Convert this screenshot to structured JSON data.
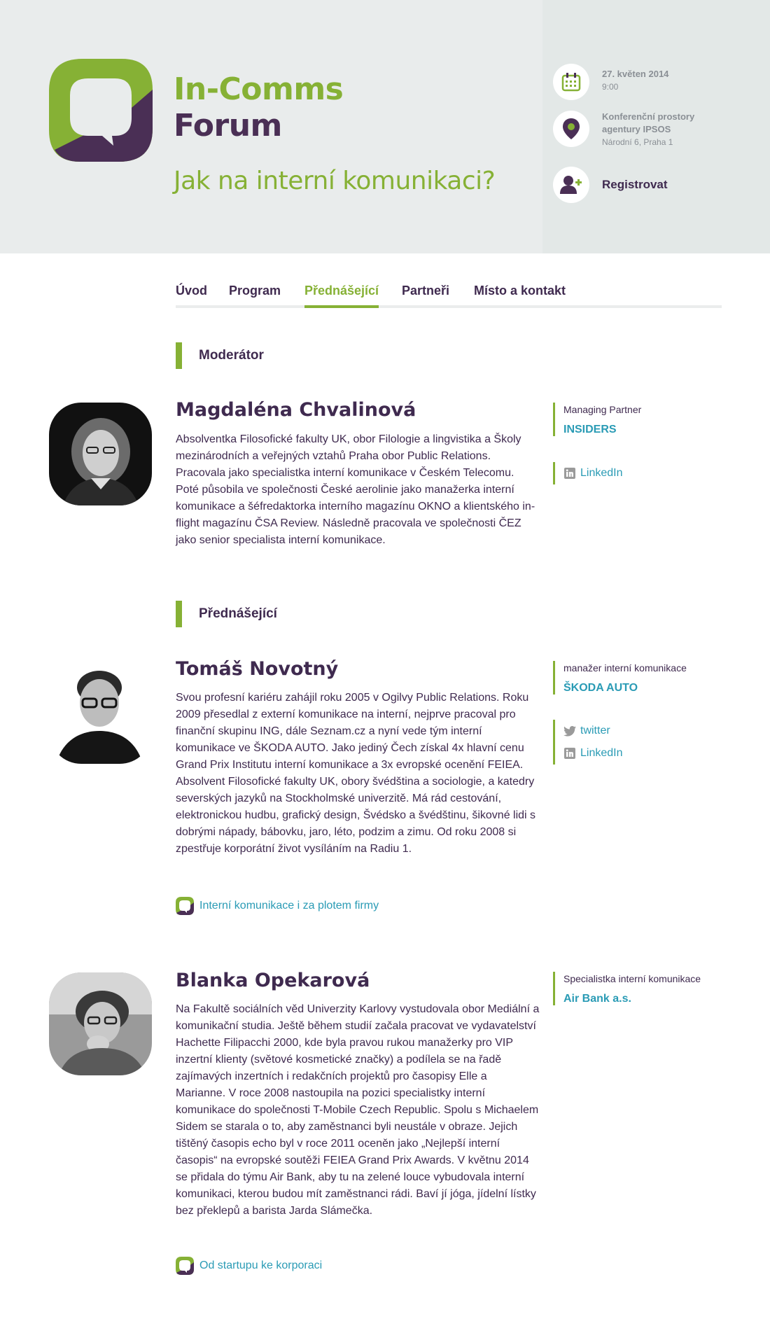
{
  "header": {
    "brand_line1": "In-Comms",
    "brand_line2": "Forum",
    "tagline": "Jak na interní komunikaci?",
    "date": "27. květen 2014",
    "time": "9:00",
    "venue_line1": "Konferenční prostory",
    "venue_line2": "agentury IPSOS",
    "venue_address": "Národní 6, Praha 1",
    "register_label": "Registrovat"
  },
  "nav": {
    "items": [
      "Úvod",
      "Program",
      "Přednášející",
      "Partneři",
      "Místo a kontakt"
    ],
    "active": "Přednášející"
  },
  "sections": {
    "moderator": "Moderátor",
    "speakers": "Přednášející"
  },
  "people": [
    {
      "name": "Magdaléna Chvalinová",
      "bio": "Absolventka Filosofické fakulty UK, obor Filologie a lingvistika a Školy mezinárodních a veřejných vztahů Praha obor Public Relations. Pracovala jako specialistka interní komunikace v Českém Telecomu. Poté působila ve společnosti České aerolinie jako manažerka interní komunikace a šéfredaktorka interního magazínu OKNO a klientského in-flight magazínu ČSA Review. Následně pracovala ve společnosti ČEZ jako senior specialista interní komunikace.",
      "role": "Managing Partner",
      "company": "INSIDERS",
      "links": [
        "LinkedIn"
      ]
    },
    {
      "name": "Tomáš Novotný",
      "bio": "Svou profesní kariéru zahájil roku 2005 v Ogilvy Public Relations. Roku 2009 přesedlal z externí komunikace na interní, nejprve pracoval pro finanční skupinu ING, dále Seznam.cz a nyní vede tým interní komunikace ve ŠKODA AUTO. Jako jediný Čech získal 4x hlavní cenu Grand Prix Institutu interní komunikace a 3x evropské ocenění FEIEA. Absolvent Filosofické fakulty UK, obory švédština a sociologie, a katedry severských jazyků na Stockholmské univerzitě. Má rád cestování, elektronickou hudbu, grafický design, Švédsko a švédštinu, šikovné lidi s dobrými nápady, bábovku, jaro, léto, podzim a zimu. Od roku 2008 si zpestřuje korporátní život vysíláním na Radiu 1.",
      "role": "manažer interní komunikace",
      "company": "ŠKODA AUTO",
      "links": [
        "twitter",
        "LinkedIn"
      ],
      "talk": "Interní komunikace i za plotem firmy"
    },
    {
      "name": "Blanka Opekarová",
      "bio": "Na Fakultě sociálních věd Univerzity Karlovy vystudovala obor Mediální a komunikační studia. Ještě během studií začala pracovat ve vydavatelství Hachette Filipacchi 2000, kde byla pravou rukou manažerky pro VIP inzertní klienty (světové kosmetické značky) a podílela se na řadě zajímavých inzertních i redakčních projektů pro časopisy Elle a Marianne. V roce 2008 nastoupila na pozici specialistky interní komunikace do společnosti T-Mobile Czech Republic. Spolu s Michaelem Sidem se starala o to, aby zaměstnanci byli neustále v obraze. Jejich tištěný časopis echo byl v roce 2011 oceněn jako „Nejlepší interní časopis“ na evropské soutěži FEIEA Grand Prix Awards. V květnu 2014 se přidala do týmu Air Bank, aby tu na zelené louce vybudovala interní komunikaci, kterou budou mít zaměstnanci rádi. Baví jí jóga, jídelní lístky bez překlepů a barista Jarda Slámečka.",
      "role": "Specialistka interní komunikace",
      "company": "Air Bank a.s.",
      "links": [],
      "talk": "Od startupu ke korporaci"
    }
  ],
  "colors": {
    "green": "#86b135",
    "purple": "#3f2a4f",
    "link": "#2a9bb5",
    "header_bg": "#e9ecec"
  }
}
